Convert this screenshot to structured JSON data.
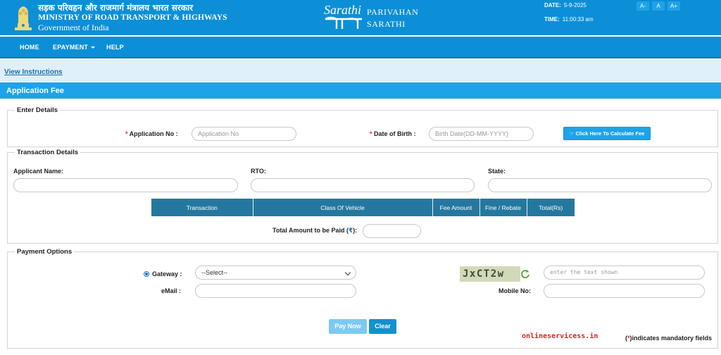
{
  "header": {
    "ministry_hindi": "सड़क परिवहन और राजमार्ग मंत्रालय भारत सरकार",
    "ministry_english": "MINISTRY OF ROAD TRANSPORT & HIGHWAYS",
    "government": "Government of India",
    "logo_text": "Sarathi",
    "portal_line1": "PARIVAHAN",
    "portal_line2": "SARATHI",
    "date_label": "DATE:",
    "date_value": "5-9-2025",
    "time_label": "TIME:",
    "time_value": "11:00:33 am",
    "font_buttons": [
      "A-",
      "A",
      "A+"
    ]
  },
  "nav": {
    "home": "HOME",
    "epayment": "EPAYMENT",
    "help": "HELP"
  },
  "instructions_link": "View Instructions",
  "section_title": "Application Fee",
  "enter_details": {
    "legend": "Enter Details",
    "application_no_label": "Application No :",
    "application_no_placeholder": "Application No",
    "dob_label": "Date of Birth :",
    "dob_placeholder": "Birth Date(DD-MM-YYYY)",
    "calc_button": "Click Here To Calculate Fee"
  },
  "transaction": {
    "legend": "Transaction Details",
    "applicant_name_label": "Applicant Name:",
    "rto_label": "RTO:",
    "state_label": "State:",
    "columns": [
      "Transaction",
      "Class Of Vehicle",
      "Fee Amount",
      "Fine / Rebate",
      "Total(Rs)"
    ],
    "total_label_prefix": "Total Amount to be Paid (",
    "rupee_symbol": "₹",
    "total_label_suffix": "):"
  },
  "payment": {
    "legend": "Payment Options",
    "gateway_label": "Gateway :",
    "gateway_selected": "--Select--",
    "captcha_text": "JxCT2w",
    "captcha_placeholder": "enter the text shown",
    "email_label": "eMail :",
    "mobile_label": "Mobile No:",
    "pay_button": "Pay Now",
    "clear_button": "Clear"
  },
  "watermark": "onlineservicess.in",
  "mandatory_note_prefix": "(",
  "mandatory_star": "*",
  "mandatory_note_suffix": ")indicates mandatory fields",
  "colors": {
    "header_blue": "#0c8fd6",
    "accent_blue": "#1ea3e8",
    "table_header": "#24789f",
    "required_red": "#e23333"
  }
}
